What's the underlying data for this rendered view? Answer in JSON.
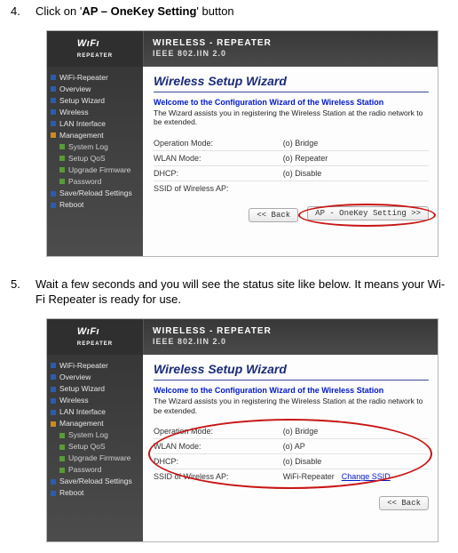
{
  "steps": {
    "s4_num": "4.",
    "s4_pre": "Click on '",
    "s4_mid": "AP – OneKey Setting",
    "s4_post": "' button",
    "s5_num": "5.",
    "s5_text": "Wait a few seconds and you will see the status site like below. It means your Wi-Fi Repeater is ready for use."
  },
  "top": {
    "logo_text": "WıFı",
    "logo_sub": "REPEATER",
    "title1": "WIRELESS - REPEATER",
    "title2": "IEEE 802.IIN 2.0"
  },
  "nav": {
    "items": [
      {
        "label": "WiFi-Repeater",
        "color": "blue",
        "child": false
      },
      {
        "label": "Overview",
        "color": "blue",
        "child": false
      },
      {
        "label": "Setup Wizard",
        "color": "blue",
        "child": false
      },
      {
        "label": "Wireless",
        "color": "blue",
        "child": false
      },
      {
        "label": "LAN Interface",
        "color": "blue",
        "child": false
      },
      {
        "label": "Management",
        "color": "orange",
        "child": false
      },
      {
        "label": "System Log",
        "color": "green",
        "child": true
      },
      {
        "label": "Setup QoS",
        "color": "green",
        "child": true
      },
      {
        "label": "Upgrade Firmware",
        "color": "green",
        "child": true
      },
      {
        "label": "Password",
        "color": "green",
        "child": true
      },
      {
        "label": "Save/Reload Settings",
        "color": "blue",
        "child": false
      },
      {
        "label": "Reboot",
        "color": "blue",
        "child": false
      }
    ]
  },
  "wizard": {
    "title": "Wireless Setup Wizard",
    "welcome": "Welcome to the Configuration Wizard of the Wireless Station",
    "desc": "The Wizard assists you in registering the Wireless Station at the radio network to be extended."
  },
  "panel1": {
    "rows": [
      {
        "k": "Operation Mode:",
        "v": "(o) Bridge"
      },
      {
        "k": "WLAN Mode:",
        "v": "(o) Repeater"
      },
      {
        "k": "DHCP:",
        "v": "(o) Disable"
      },
      {
        "k": "SSID of Wireless AP:",
        "v": ""
      }
    ],
    "back": "<<  Back",
    "onekey": "AP - OneKey Setting >>"
  },
  "panel2": {
    "rows": [
      {
        "k": "Operation Mode:",
        "v": "(o) Bridge"
      },
      {
        "k": "WLAN Mode:",
        "v": "(o) AP"
      },
      {
        "k": "DHCP:",
        "v": "(o) Disable"
      },
      {
        "k": "SSID of Wireless AP:",
        "v": "WiFi-Repeater",
        "link": "Change SSID"
      }
    ],
    "back": "<<  Back"
  }
}
